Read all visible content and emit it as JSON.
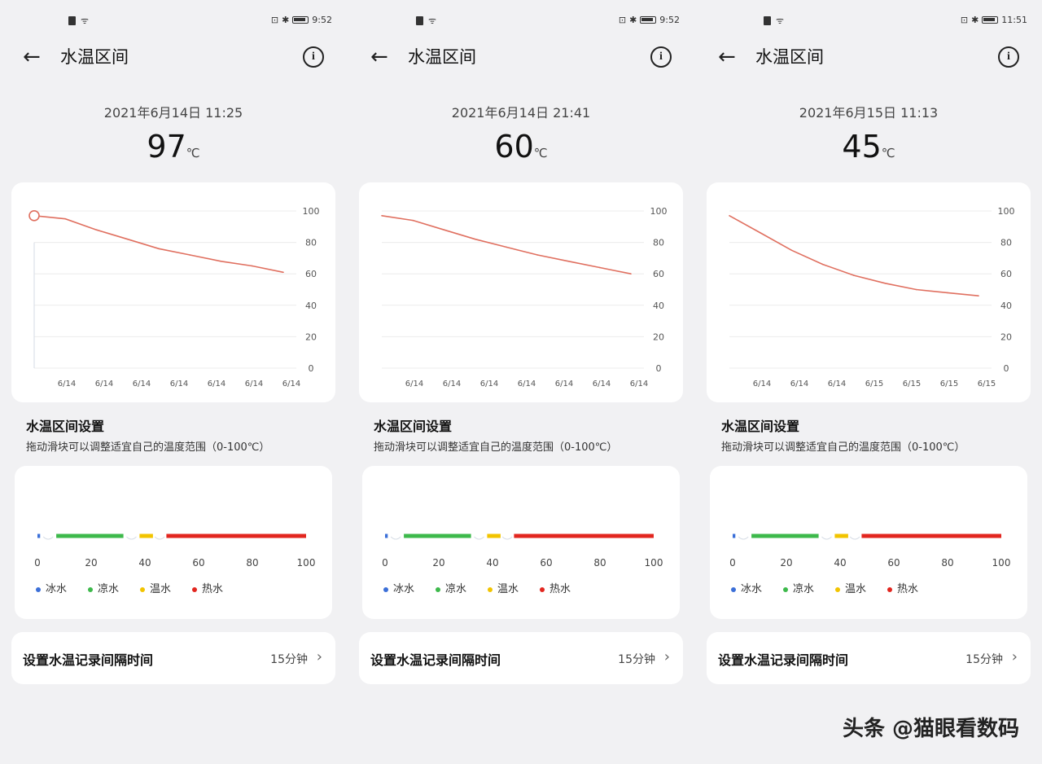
{
  "page_title": "水温区间",
  "section": {
    "title": "水温区间设置",
    "subtitle": "拖动滑块可以调整适宜自己的温度范围（0-100℃）"
  },
  "range_ticks": [
    "0",
    "20",
    "40",
    "60",
    "80",
    "100"
  ],
  "legend": [
    {
      "label": "冰水",
      "color": "#3b6fd8"
    },
    {
      "label": "凉水",
      "color": "#3db94b"
    },
    {
      "label": "温水",
      "color": "#f2c400"
    },
    {
      "label": "热水",
      "color": "#e2261f"
    }
  ],
  "interval": {
    "label": "设置水温记录间隔时间",
    "value": "15分钟"
  },
  "unit": "℃",
  "watermark": "头条 @猫眼看数码",
  "screens": [
    {
      "time": "9:52",
      "datetime": "2021年6月14日 11:25",
      "value": "97",
      "x_labels": [
        "6/14",
        "6/14",
        "6/14",
        "6/14",
        "6/14",
        "6/14",
        "6/14"
      ],
      "selected": true
    },
    {
      "time": "9:52",
      "datetime": "2021年6月14日 21:41",
      "value": "60",
      "x_labels": [
        "6/14",
        "6/14",
        "6/14",
        "6/14",
        "6/14",
        "6/14",
        "6/14"
      ],
      "selected": false
    },
    {
      "time": "11:51",
      "datetime": "2021年6月15日 11:13",
      "value": "45",
      "x_labels": [
        "6/14",
        "6/14",
        "6/14",
        "6/15",
        "6/15",
        "6/15",
        "6/15"
      ],
      "selected": false
    }
  ],
  "chart_data": [
    {
      "type": "line",
      "y_ticks": [
        100,
        80,
        60,
        40,
        20,
        0
      ],
      "ylim": [
        0,
        100
      ],
      "grid": true,
      "series": [
        {
          "values": [
            97,
            95,
            88,
            82,
            76,
            72,
            68,
            65,
            61
          ]
        }
      ]
    },
    {
      "type": "line",
      "y_ticks": [
        100,
        80,
        60,
        40,
        20,
        0
      ],
      "ylim": [
        0,
        100
      ],
      "grid": true,
      "series": [
        {
          "values": [
            97,
            94,
            88,
            82,
            77,
            72,
            68,
            64,
            60
          ]
        }
      ]
    },
    {
      "type": "line",
      "y_ticks": [
        100,
        80,
        60,
        40,
        20,
        0
      ],
      "ylim": [
        0,
        100
      ],
      "grid": true,
      "series": [
        {
          "values": [
            97,
            86,
            75,
            66,
            59,
            54,
            50,
            48,
            46
          ]
        }
      ]
    }
  ]
}
